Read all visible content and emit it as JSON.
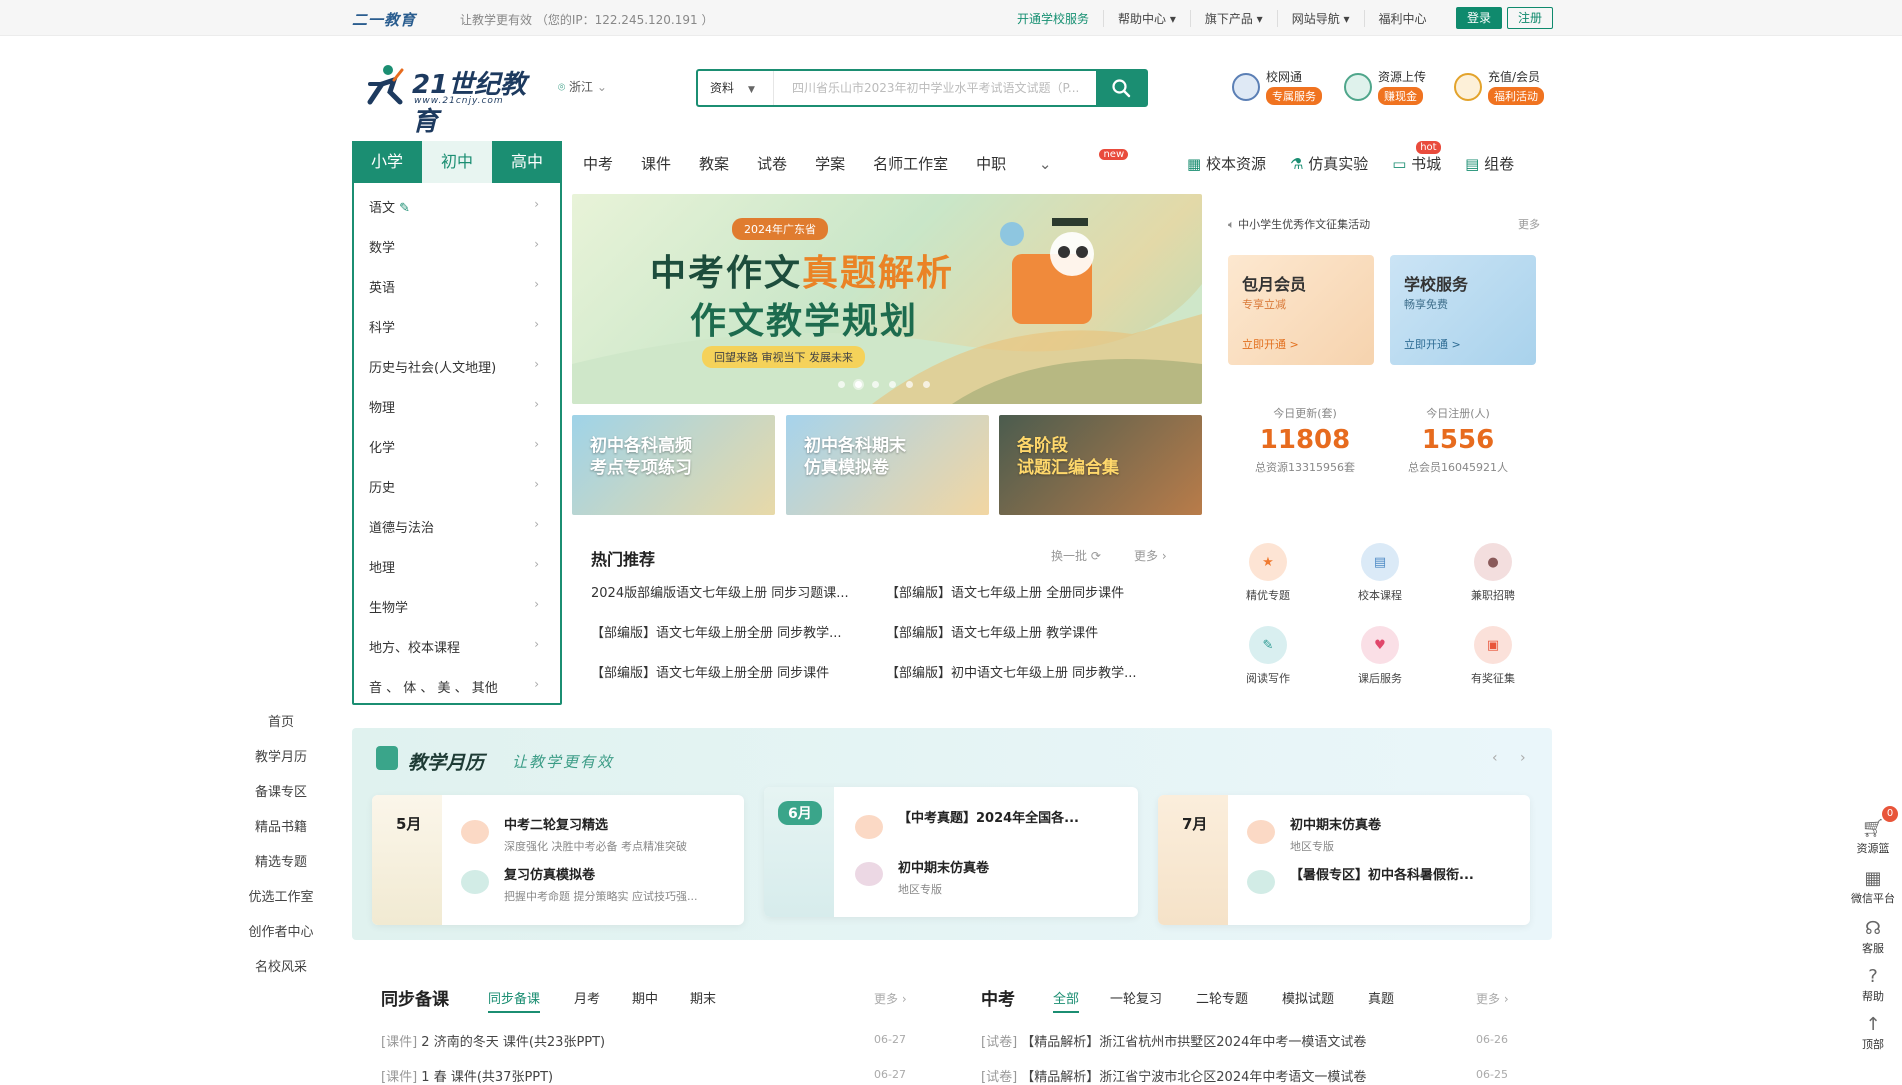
{
  "topbar": {
    "brand": "二一教育",
    "slogan": "让教学更有效 （您的IP：122.245.120.191 ）",
    "links": [
      "开通学校服务",
      "帮助中心 ▾",
      "旗下产品 ▾",
      "网站导航 ▾",
      "福利中心"
    ],
    "login": "登录",
    "register": "注册"
  },
  "header": {
    "logo_text": "21世纪教育",
    "logo_url_text": "www.21cnjy.com",
    "region": "浙江",
    "search_type": "资料",
    "search_placeholder": "四川省乐山市2023年初中学业水平考试语文试题（P...",
    "icons": [
      {
        "name": "校网通",
        "tag": "专属服务"
      },
      {
        "name": "资源上传",
        "tag": "赚现金"
      },
      {
        "name": "充值/会员",
        "tag": "福利活动"
      }
    ]
  },
  "stages": [
    "小学",
    "初中",
    "高中"
  ],
  "subjects": [
    "语文",
    "数学",
    "英语",
    "科学",
    "历史与社会(人文地理)",
    "物理",
    "化学",
    "历史",
    "道德与法治",
    "地理",
    "生物学",
    "地方、校本课程",
    "音 、 体 、 美 、 其他"
  ],
  "mainnav": [
    "中考",
    "课件",
    "教案",
    "试卷",
    "学案",
    "名师工作室",
    "中职"
  ],
  "mainnav_badge": "new",
  "rightnav": [
    "校本资源",
    "仿真实验",
    "书城",
    "组卷"
  ],
  "rightnav_badge": "hot",
  "banner": {
    "tag": "2024年广东省",
    "line1a": "中考作文",
    "line1b": "真题解析",
    "line2": "作文教学规划",
    "line3": "回望来路  审视当下  发展未来"
  },
  "mini_banners": [
    "初中各科高频\n考点专项练习",
    "初中各科期末\n仿真模拟卷",
    "各阶段\n试题汇编合集"
  ],
  "notice": {
    "text": "中小学生优秀作文征集活动",
    "more": "更多"
  },
  "vip_cards": [
    {
      "title": "包月会员",
      "sub": "专享立减",
      "cta": "立即开通 >"
    },
    {
      "title": "学校服务",
      "sub": "畅享免费",
      "cta": "立即开通 >"
    }
  ],
  "stats": [
    {
      "label": "今日更新(套)",
      "value": "11808",
      "sub": "总资源13315956套"
    },
    {
      "label": "今日注册(人)",
      "value": "1556",
      "sub": "总会员16045921人"
    }
  ],
  "hot": {
    "title": "热门推荐",
    "switch": "换一批 ⟳",
    "more": "更多 ›",
    "items": [
      "2024版部编版语文七年级上册 同步习题课...",
      "【部编版】语文七年级上册 全册同步课件",
      "【部编版】语文七年级上册全册 同步教学...",
      "【部编版】语文七年级上册 教学课件",
      "【部编版】语文七年级上册全册 同步课件",
      "【部编版】初中语文七年级上册 同步教学..."
    ]
  },
  "quick": [
    "精优专题",
    "校本课程",
    "兼职招聘",
    "阅读写作",
    "课后服务",
    "有奖征集"
  ],
  "leftnav": [
    "首页",
    "教学月历",
    "备课专区",
    "精品书籍",
    "精选专题",
    "优选工作室",
    "创作者中心",
    "名校风采"
  ],
  "calendar": {
    "title": "教学月历",
    "subtitle": "让教学更有效",
    "cards": [
      {
        "month": "5月",
        "items": [
          {
            "t": "中考二轮复习精选",
            "s": "深度强化  决胜中考必备  考点精准突破"
          },
          {
            "t": "复习仿真模拟卷",
            "s": "把握中考命题  提分策略实  应试技巧强..."
          }
        ]
      },
      {
        "month": "6月",
        "items": [
          {
            "t": "【中考真题】2024年全国各...",
            "s": ""
          },
          {
            "t": "初中期末仿真卷",
            "s": "地区专版"
          }
        ]
      },
      {
        "month": "7月",
        "items": [
          {
            "t": "初中期末仿真卷",
            "s": "地区专版"
          },
          {
            "t": "【暑假专区】初中各科暑假衔...",
            "s": ""
          }
        ]
      }
    ]
  },
  "sync": {
    "title": "同步备课",
    "tabs": [
      "同步备课",
      "月考",
      "期中",
      "期末"
    ],
    "more": "更多 ›",
    "rows": [
      {
        "type": "[课件]",
        "text": " 2 济南的冬天 课件(共23张PPT)",
        "date": "06-27"
      },
      {
        "type": "[课件]",
        "text": " 1 春 课件(共37张PPT)",
        "date": "06-27"
      }
    ]
  },
  "zhongkao": {
    "title": "中考",
    "tabs": [
      "全部",
      "一轮复习",
      "二轮专题",
      "模拟试题",
      "真题"
    ],
    "more": "更多 ›",
    "rows": [
      {
        "type": "[试卷]",
        "text": " 【精品解析】浙江省杭州市拱墅区2024年中考一模语文试卷",
        "date": "06-26"
      },
      {
        "type": "[试卷]",
        "text": " 【精品解析】浙江省宁波市北仑区2024年中考语文一模试卷",
        "date": "06-25"
      }
    ]
  },
  "rightfloat": [
    {
      "label": "资源篮",
      "badge": "0"
    },
    {
      "label": "微信平台"
    },
    {
      "label": "客服"
    },
    {
      "label": "帮助"
    },
    {
      "label": "顶部"
    }
  ],
  "colors": {
    "primary": "#1b8e72",
    "accent": "#e76b1e"
  }
}
